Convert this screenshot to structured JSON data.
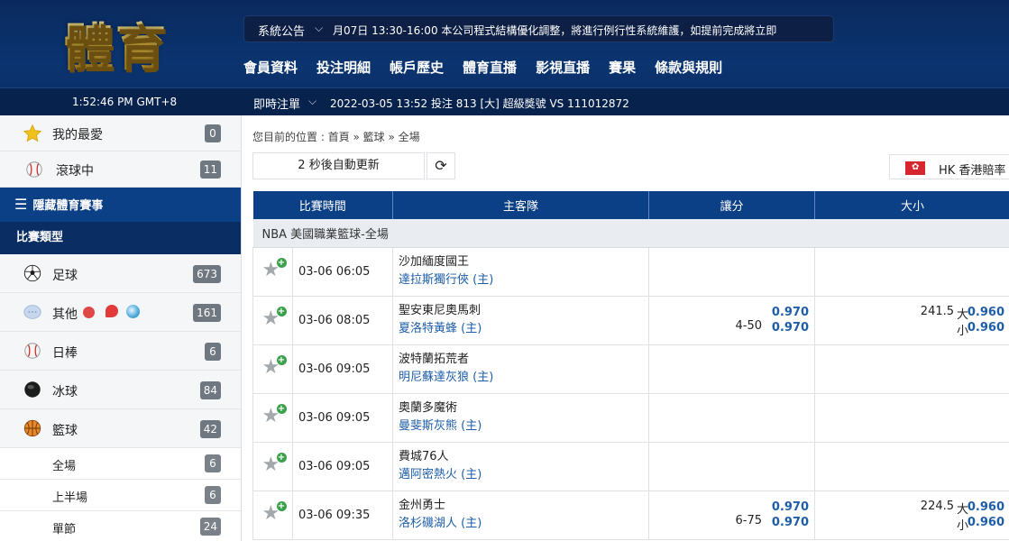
{
  "header": {
    "logo": "體育",
    "announcement_label": "系統公告",
    "announcement_text": "月07日 13:30-16:00 本公司程式結構優化調整，將進行例行性系統維護，如提前完成將立即",
    "nav": [
      "會員資料",
      "投注明細",
      "帳戶歷史",
      "體育直播",
      "影視直播",
      "賽果",
      "條款與規則"
    ],
    "clock": "1:52:46 PM GMT+8",
    "live_label": "即時注單",
    "live_text": "2022-03-05 13:52 投注 813 [大] 超級獎號 VS 111012872"
  },
  "sidebar": {
    "favorites": {
      "label": "我的最愛",
      "count": "0"
    },
    "inplay": {
      "label": "滾球中",
      "count": "11"
    },
    "hide_label": "隱藏體育賽事",
    "types_label": "比賽類型",
    "sports": [
      {
        "label": "足球",
        "count": "673"
      },
      {
        "label": "其他",
        "count": "161"
      },
      {
        "label": "日棒",
        "count": "6"
      },
      {
        "label": "冰球",
        "count": "84"
      },
      {
        "label": "籃球",
        "count": "42"
      }
    ],
    "basketball_sub": [
      {
        "label": "全場",
        "count": "6"
      },
      {
        "label": "上半場",
        "count": "6"
      },
      {
        "label": "單節",
        "count": "24"
      }
    ]
  },
  "main": {
    "breadcrumb": "您目前的位置 : 首頁 » 籃球 » 全場",
    "refresh_text": "2 秒後自動更新",
    "region_code": "HK",
    "region_label": "HK 香港賠率",
    "table": {
      "headers": [
        "比賽時間",
        "主客隊",
        "讓分",
        "大小"
      ],
      "league": "NBA 美國職業籃球-全場",
      "matches": [
        {
          "time": "03-06 06:05",
          "home": "沙加緬度國王",
          "away": "達拉斯獨行俠 (主)",
          "hcp": "",
          "hcp_o1": "",
          "hcp_o2": "",
          "ou": "",
          "ou_o1": "",
          "ou_o2": "",
          "ou_l1": "",
          "ou_l2": ""
        },
        {
          "time": "03-06 08:05",
          "home": "聖安東尼奧馬刺",
          "away": "夏洛特黃蜂 (主)",
          "hcp": "4-50",
          "hcp_o1": "0.970",
          "hcp_o2": "0.970",
          "ou": "241.5",
          "ou_o1": "0.960",
          "ou_o2": "0.960",
          "ou_l1": "大",
          "ou_l2": "小"
        },
        {
          "time": "03-06 09:05",
          "home": "波特蘭拓荒者",
          "away": "明尼蘇達灰狼 (主)",
          "hcp": "",
          "hcp_o1": "",
          "hcp_o2": "",
          "ou": "",
          "ou_o1": "",
          "ou_o2": "",
          "ou_l1": "",
          "ou_l2": ""
        },
        {
          "time": "03-06 09:05",
          "home": "奧蘭多魔術",
          "away": "曼斐斯灰熊 (主)",
          "hcp": "",
          "hcp_o1": "",
          "hcp_o2": "",
          "ou": "",
          "ou_o1": "",
          "ou_o2": "",
          "ou_l1": "",
          "ou_l2": ""
        },
        {
          "time": "03-06 09:05",
          "home": "費城76人",
          "away": "邁阿密熱火 (主)",
          "hcp": "",
          "hcp_o1": "",
          "hcp_o2": "",
          "ou": "",
          "ou_o1": "",
          "ou_o2": "",
          "ou_l1": "",
          "ou_l2": ""
        },
        {
          "time": "03-06 09:35",
          "home": "金州勇士",
          "away": "洛杉磯湖人 (主)",
          "hcp": "6-75",
          "hcp_o1": "0.970",
          "hcp_o2": "0.970",
          "ou": "224.5",
          "ou_o1": "0.960",
          "ou_o2": "0.960",
          "ou_l1": "大",
          "ou_l2": "小"
        }
      ]
    }
  },
  "colors": {
    "nav_blue": "#0b3f86",
    "header_dark": "#0a2a5e",
    "odds_blue": "#1e5ea8",
    "badge_gray": "#6f7780"
  }
}
